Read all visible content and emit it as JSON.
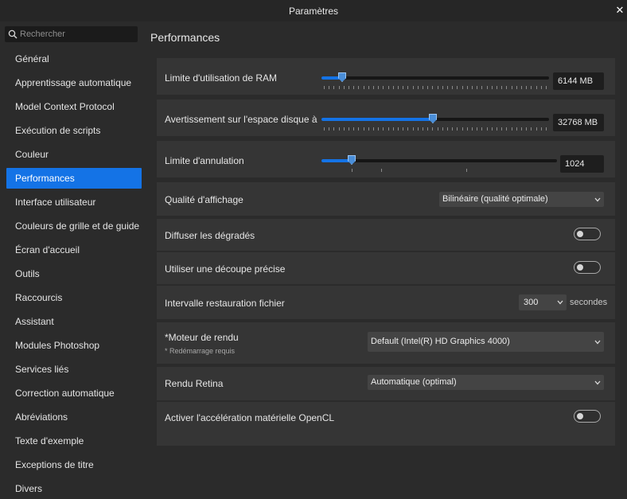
{
  "window": {
    "title": "Paramètres",
    "close_glyph": "✕"
  },
  "search": {
    "placeholder": "Rechercher",
    "icon": "search-icon"
  },
  "sidebar": {
    "items": [
      {
        "label": "Général"
      },
      {
        "label": "Apprentissage automatique"
      },
      {
        "label": "Model Context Protocol"
      },
      {
        "label": "Exécution de scripts"
      },
      {
        "label": "Couleur"
      },
      {
        "label": "Performances",
        "active": true
      },
      {
        "label": "Interface utilisateur"
      },
      {
        "label": "Couleurs de grille et de guide"
      },
      {
        "label": "Écran d'accueil"
      },
      {
        "label": "Outils"
      },
      {
        "label": "Raccourcis"
      },
      {
        "label": "Assistant"
      },
      {
        "label": "Modules Photoshop"
      },
      {
        "label": "Services liés"
      },
      {
        "label": "Correction automatique"
      },
      {
        "label": "Abréviations"
      },
      {
        "label": "Texte d'exemple"
      },
      {
        "label": "Exceptions de titre"
      },
      {
        "label": "Divers"
      }
    ]
  },
  "main": {
    "title": "Performances",
    "ram": {
      "label": "Limite d'utilisation de RAM",
      "value": "6144 MB",
      "fraction": 0.09
    },
    "disk": {
      "label": "Avertissement sur l'espace disque à",
      "value": "32768 MB",
      "fraction": 0.49
    },
    "undo": {
      "label": "Limite d'annulation",
      "value": "1024",
      "fraction": 0.13
    },
    "display_quality": {
      "label": "Qualité d'affichage",
      "value": "Bilinéaire (qualité optimale)"
    },
    "dither": {
      "label": "Diffuser les dégradés",
      "on": false
    },
    "precise_clip": {
      "label": "Utiliser une découpe précise",
      "on": false
    },
    "file_recovery": {
      "label": "Intervalle restauration fichier",
      "value": "300",
      "unit": "secondes"
    },
    "render_engine": {
      "label": "*Moteur de rendu",
      "note": "* Redémarrage requis",
      "value": "Default (Intel(R) HD Graphics 4000)"
    },
    "retina": {
      "label": "Rendu Retina",
      "value": "Automatique (optimal)"
    },
    "opencl": {
      "label": "Activer l'accélération matérielle OpenCL",
      "on": false
    }
  },
  "colors": {
    "accent": "#1473e6",
    "background": "#2b2b2b",
    "row": "#353535"
  }
}
